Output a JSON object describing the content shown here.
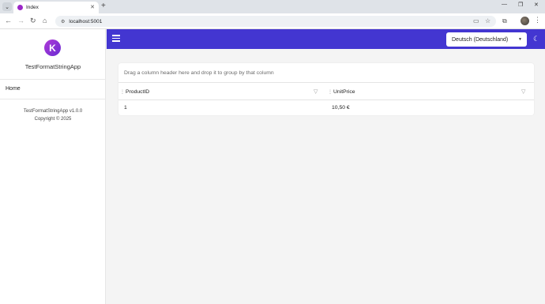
{
  "browser": {
    "tab_title": "Index",
    "url": "localhost:5001"
  },
  "sidebar": {
    "app_name": "TestFormatStringApp",
    "logo_letter": "K",
    "nav": [
      {
        "label": "Home"
      }
    ],
    "version": "TestFormatStringApp v1.0.0",
    "copyright": "Copyright © 2025"
  },
  "appbar": {
    "language_selected": "Deutsch (Deutschland)"
  },
  "grid": {
    "group_hint": "Drag a column header here and drop it to group by that column",
    "columns": [
      "ProductID",
      "UnitPrice"
    ],
    "rows": [
      [
        "1",
        "10,50 €"
      ]
    ]
  },
  "colors": {
    "appbar": "#4336d1",
    "logo": "#9b27c7"
  }
}
